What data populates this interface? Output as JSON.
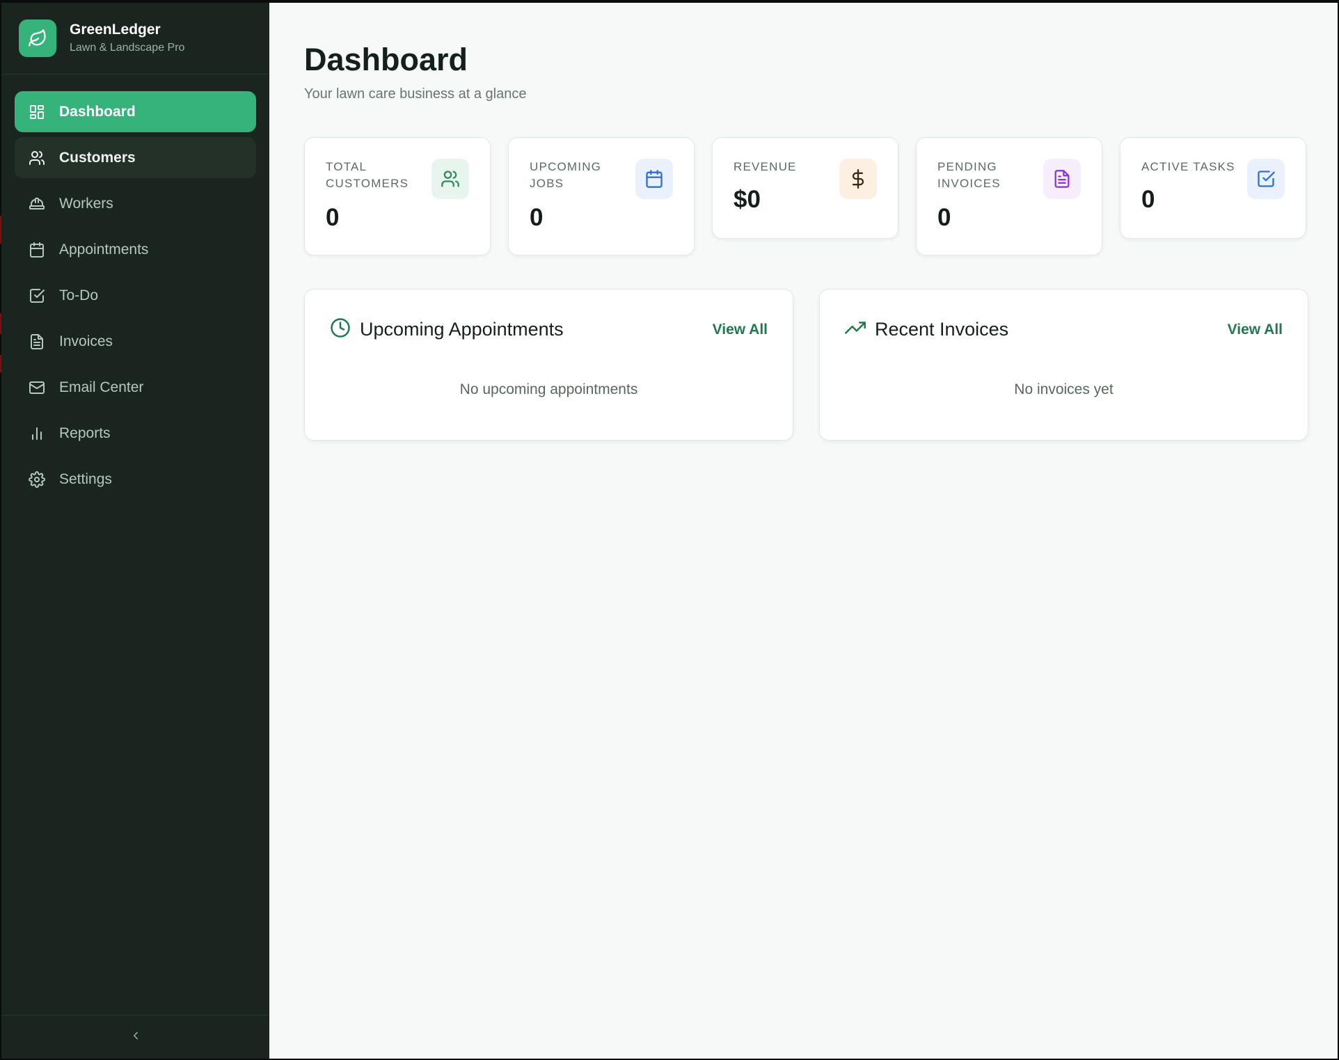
{
  "brand": {
    "name": "GreenLedger",
    "subtitle": "Lawn & Landscape Pro"
  },
  "sidebar": {
    "items": [
      {
        "label": "Dashboard",
        "icon": "dashboard-grid-icon",
        "state": "active"
      },
      {
        "label": "Customers",
        "icon": "users-icon",
        "state": "hover"
      },
      {
        "label": "Workers",
        "icon": "hard-hat-icon"
      },
      {
        "label": "Appointments",
        "icon": "calendar-icon"
      },
      {
        "label": "To-Do",
        "icon": "check-square-icon"
      },
      {
        "label": "Invoices",
        "icon": "file-text-icon"
      },
      {
        "label": "Email Center",
        "icon": "mail-icon"
      },
      {
        "label": "Reports",
        "icon": "bar-chart-icon"
      },
      {
        "label": "Settings",
        "icon": "gear-icon"
      }
    ],
    "collapse_icon": "chevron-left-icon"
  },
  "header": {
    "title": "Dashboard",
    "subtitle": "Your lawn care business at a glance"
  },
  "stats": [
    {
      "label": "TOTAL CUSTOMERS",
      "value": "0",
      "icon": "users-icon",
      "icon_bg": "#e8f4ee",
      "icon_color": "#2f8a5e"
    },
    {
      "label": "UPCOMING JOBS",
      "value": "0",
      "icon": "calendar-icon",
      "icon_bg": "#eaf1fd",
      "icon_color": "#2f6fd6"
    },
    {
      "label": "REVENUE",
      "value": "$0",
      "icon": "dollar-icon",
      "icon_bg": "#fdf0e2",
      "icon_color": "#3a2a18"
    },
    {
      "label": "PENDING INVOICES",
      "value": "0",
      "icon": "file-text-icon",
      "icon_bg": "#f6eefd",
      "icon_color": "#8a3ad0"
    },
    {
      "label": "ACTIVE TASKS",
      "value": "0",
      "icon": "check-square-icon",
      "icon_bg": "#eaf1fd",
      "icon_color": "#2f6fd6"
    }
  ],
  "panels": {
    "appointments": {
      "title": "Upcoming Appointments",
      "icon": "clock-icon",
      "view_all": "View All",
      "empty": "No upcoming appointments"
    },
    "invoices": {
      "title": "Recent Invoices",
      "icon": "trending-up-icon",
      "view_all": "View All",
      "empty": "No invoices yet"
    }
  },
  "colors": {
    "sidebar_bg": "#1a2520",
    "accent": "#36b37a",
    "link": "#1f7a4d"
  }
}
